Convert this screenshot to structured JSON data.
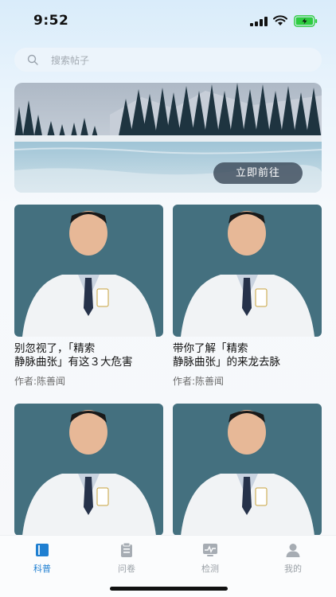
{
  "status_bar": {
    "time": "9:52"
  },
  "search": {
    "placeholder": "搜索帖子"
  },
  "banner": {
    "button_label": "立即前往"
  },
  "posts": [
    {
      "title": "别忽视了，「精索\n静脉曲张」有这３大危害",
      "author": "作者:陈善闻"
    },
    {
      "title": "带你了解「精索\n静脉曲张」的来龙去脉",
      "author": "作者:陈善闻"
    },
    {
      "title": "",
      "author": ""
    },
    {
      "title": "",
      "author": ""
    }
  ],
  "tabs": [
    {
      "label": "科普",
      "icon": "book-icon",
      "active": true
    },
    {
      "label": "问卷",
      "icon": "clipboard-icon",
      "active": false
    },
    {
      "label": "检测",
      "icon": "monitor-icon",
      "active": false
    },
    {
      "label": "我的",
      "icon": "person-icon",
      "active": false
    }
  ],
  "colors": {
    "accent": "#1f7fd1",
    "tab_inactive": "#9aa0a6"
  }
}
